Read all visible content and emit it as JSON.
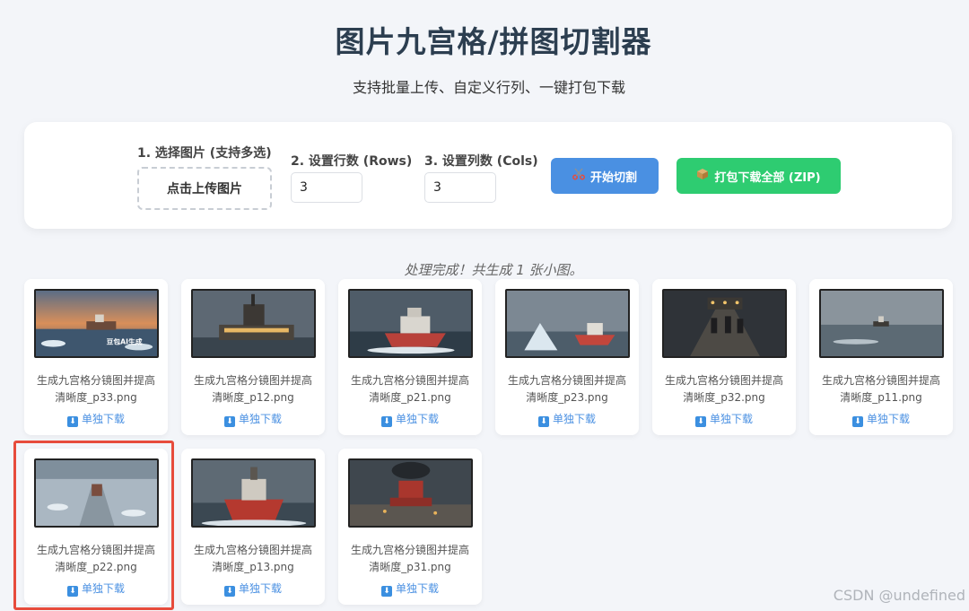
{
  "header": {
    "title": "图片九宫格/拼图切割器",
    "subtitle": "支持批量上传、自定义行列、一键打包下载"
  },
  "controls": {
    "upload_label": "1. 选择图片 (支持多选)",
    "upload_button": "点击上传图片",
    "rows_label": "2. 设置行数 (Rows)",
    "rows_value": "3",
    "cols_label": "3. 设置列数 (Cols)",
    "cols_value": "3",
    "cut_button": "开始切割",
    "cut_icon": "scissors-icon",
    "zip_button": "打包下载全部 (ZIP)",
    "zip_icon": "package-icon"
  },
  "status": "处理完成！共生成 1 张小图。",
  "results": {
    "download_label": "单独下载",
    "items": [
      {
        "line1": "生成九宫格分镜图并提高",
        "line2": "清晰度_p33.png",
        "thumb_text": "豆包AI生成"
      },
      {
        "line1": "生成九宫格分镜图并提高",
        "line2": "清晰度_p12.png"
      },
      {
        "line1": "生成九宫格分镜图并提高",
        "line2": "清晰度_p21.png"
      },
      {
        "line1": "生成九宫格分镜图并提高",
        "line2": "清晰度_p23.png"
      },
      {
        "line1": "生成九宫格分镜图并提高",
        "line2": "清晰度_p32.png"
      },
      {
        "line1": "生成九宫格分镜图并提高",
        "line2": "清晰度_p11.png"
      },
      {
        "line1": "生成九宫格分镜图并提高",
        "line2": "清晰度_p22.png"
      },
      {
        "line1": "生成九宫格分镜图并提高",
        "line2": "清晰度_p13.png"
      },
      {
        "line1": "生成九宫格分镜图并提高",
        "line2": "清晰度_p31.png"
      }
    ]
  },
  "watermark": "CSDN @undefined",
  "colors": {
    "primary": "#4a90e2",
    "success": "#2ecc71",
    "highlight": "#e74c3c"
  }
}
